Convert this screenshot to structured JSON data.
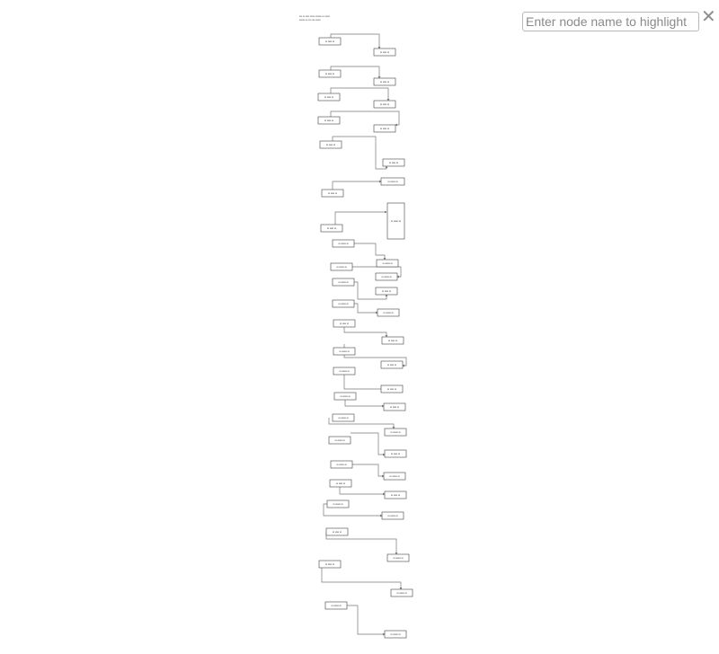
{
  "search": {
    "placeholder": "Enter node name to highlight",
    "value": ""
  },
  "close_icon": "close-icon",
  "colors": {
    "edge": "#777777",
    "node_border": "#444444",
    "node_fill": "#ffffff",
    "node_text": "#222222"
  },
  "diagram": {
    "title_lines": [
      "▪▪▪ ▪▪ ▪▪▪▪ ▪▪▪▪▪ ▪▪▪▪▪▪ ▪▪ ▪▪▪▪▪",
      "▪▪▪▪▪▪ ▪▪ ▪▪▪ ▪▪▪ ▪▪▪▪▪"
    ],
    "node_label_short": "▪▪ ▪▪▪▪ ▪▪",
    "node_label_long": "▪▪ ▪▪▪▪▪ ▪▪"
  }
}
